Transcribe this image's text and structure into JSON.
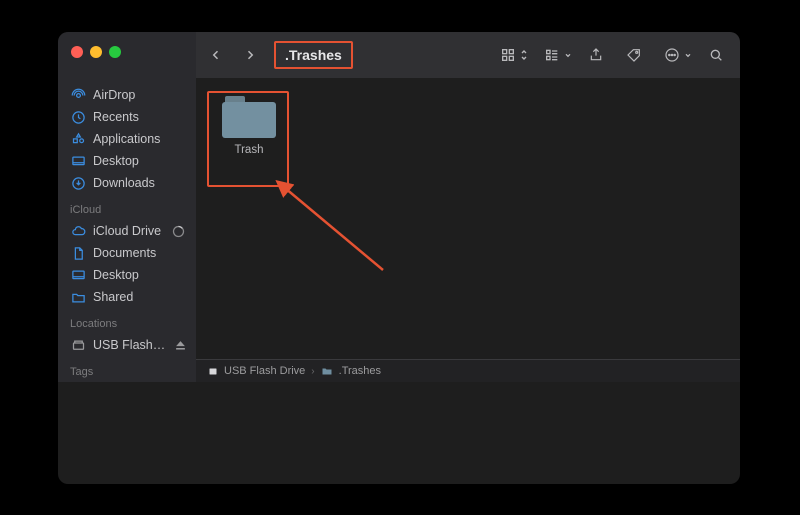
{
  "window": {
    "title": ".Trashes"
  },
  "sidebar": {
    "favorites": [
      {
        "label": "AirDrop",
        "icon": "airdrop"
      },
      {
        "label": "Recents",
        "icon": "clock"
      },
      {
        "label": "Applications",
        "icon": "apps"
      },
      {
        "label": "Desktop",
        "icon": "desktop"
      },
      {
        "label": "Downloads",
        "icon": "downloads"
      }
    ],
    "icloud_label": "iCloud",
    "icloud": [
      {
        "label": "iCloud Drive",
        "icon": "cloud",
        "progress": true
      },
      {
        "label": "Documents",
        "icon": "doc"
      },
      {
        "label": "Desktop",
        "icon": "desktop"
      },
      {
        "label": "Shared",
        "icon": "shared"
      }
    ],
    "locations_label": "Locations",
    "locations": [
      {
        "label": "USB Flash…",
        "icon": "drive",
        "eject": true
      }
    ],
    "tags_label": "Tags"
  },
  "content": {
    "items": [
      {
        "label": "Trash",
        "type": "folder"
      }
    ]
  },
  "pathbar": {
    "segments": [
      {
        "label": "USB Flash Drive",
        "icon": "drive"
      },
      {
        "label": ".Trashes",
        "icon": "folder"
      }
    ]
  },
  "annotations": {
    "highlight_color": "#e55232"
  }
}
